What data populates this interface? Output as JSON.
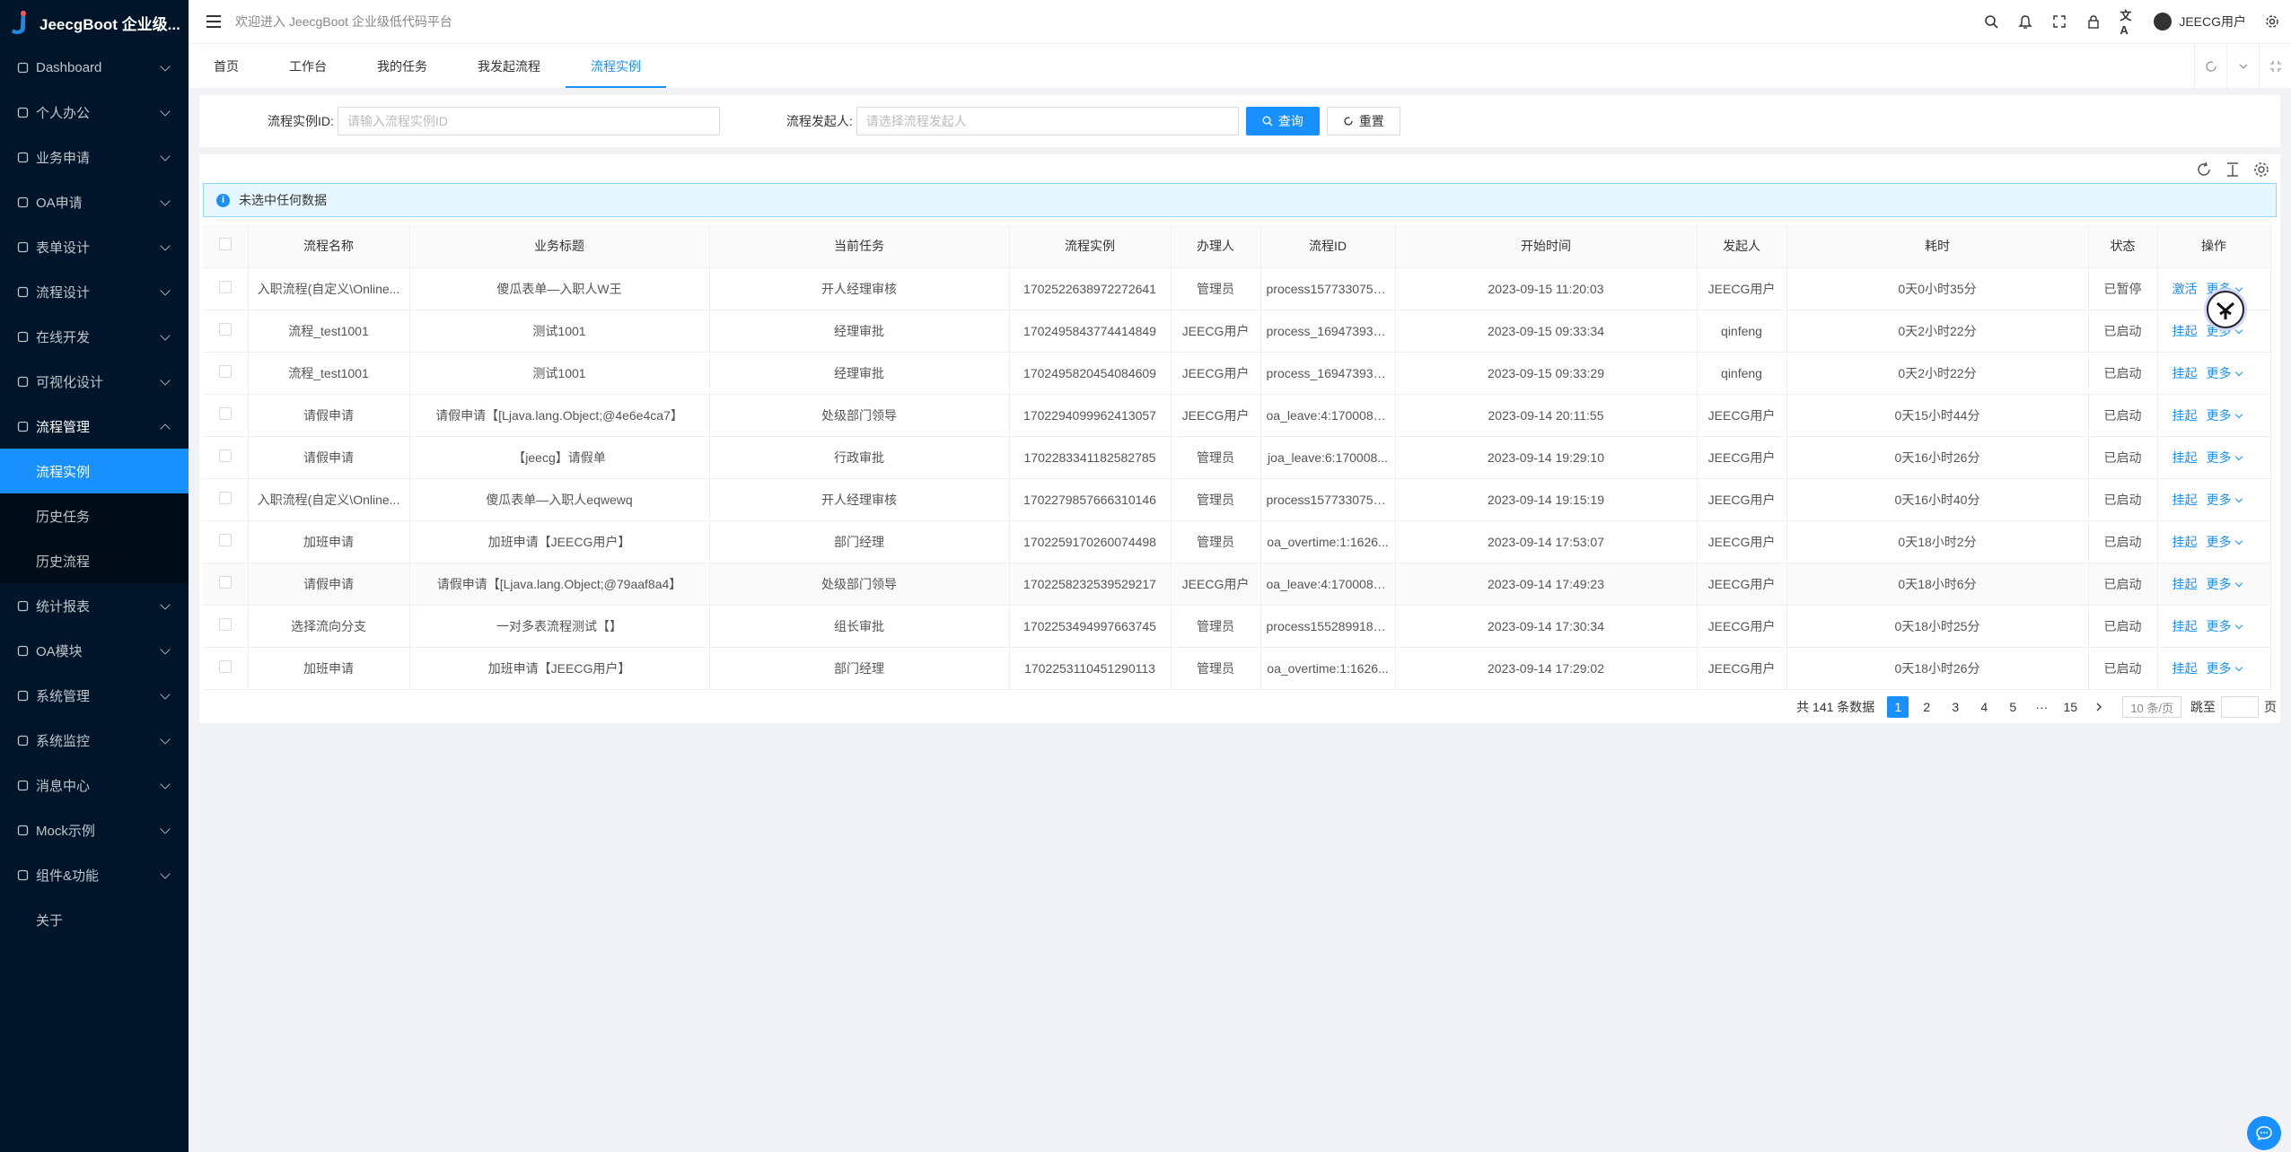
{
  "app": {
    "title": "JeecgBoot 企业级..."
  },
  "header": {
    "welcome": "欢迎进入 JeecgBoot 企业级低代码平台",
    "user_name": "JEECG用户"
  },
  "sidebar": {
    "items": [
      {
        "label": "Dashboard",
        "icon": "dashboard-icon"
      },
      {
        "label": "个人办公",
        "icon": "coffee-icon"
      },
      {
        "label": "业务申请",
        "icon": "tag-icon"
      },
      {
        "label": "OA申请",
        "icon": "oa-icon"
      },
      {
        "label": "表单设计",
        "icon": "form-icon"
      },
      {
        "label": "流程设计",
        "icon": "flow-icon"
      },
      {
        "label": "在线开发",
        "icon": "cloud-icon"
      },
      {
        "label": "可视化设计",
        "icon": "screen-icon"
      },
      {
        "label": "流程管理",
        "icon": "process-icon"
      },
      {
        "label": "统计报表",
        "icon": "chart-icon"
      },
      {
        "label": "OA模块",
        "icon": "oa-module-icon"
      },
      {
        "label": "系统管理",
        "icon": "settings-icon"
      },
      {
        "label": "系统监控",
        "icon": "monitor-icon"
      },
      {
        "label": "消息中心",
        "icon": "message-icon"
      },
      {
        "label": "Mock示例",
        "icon": "mock-icon"
      },
      {
        "label": "组件&功能",
        "icon": "component-icon"
      },
      {
        "label": "关于",
        "icon": ""
      }
    ],
    "sub_items": [
      {
        "label": "流程实例"
      },
      {
        "label": "历史任务"
      },
      {
        "label": "历史流程"
      }
    ]
  },
  "tabs": [
    {
      "label": "首页"
    },
    {
      "label": "工作台"
    },
    {
      "label": "我的任务"
    },
    {
      "label": "我发起流程"
    },
    {
      "label": "流程实例"
    }
  ],
  "search": {
    "instance_label": "流程实例ID:",
    "instance_placeholder": "请输入流程实例ID",
    "starter_label": "流程发起人:",
    "starter_placeholder": "请选择流程发起人",
    "query_label": "查询",
    "reset_label": "重置"
  },
  "alert": {
    "text": "未选中任何数据"
  },
  "table": {
    "columns": [
      "流程名称",
      "业务标题",
      "当前任务",
      "流程实例",
      "办理人",
      "流程ID",
      "开始时间",
      "发起人",
      "耗时",
      "状态",
      "操作"
    ],
    "rows": [
      {
        "name": "入职流程(自定义\\Online...",
        "title": "傻瓜表单—入职人W王",
        "task": "开人经理审核",
        "instance": "1702522638972272641",
        "handler": "管理员",
        "pid": "process1577330752...",
        "start": "2023-09-15 11:20:03",
        "starter": "JEECG用户",
        "cost": "0天0小时35分",
        "status": "已暂停",
        "action": "激活",
        "more": "更多"
      },
      {
        "name": "流程_test1001",
        "title": "测试1001",
        "task": "经理审批",
        "instance": "1702495843774414849",
        "handler": "JEECG用户",
        "pid": "process_169473934...",
        "start": "2023-09-15 09:33:34",
        "starter": "qinfeng",
        "cost": "0天2小时22分",
        "status": "已启动",
        "action": "挂起",
        "more": "更多"
      },
      {
        "name": "流程_test1001",
        "title": "测试1001",
        "task": "经理审批",
        "instance": "1702495820454084609",
        "handler": "JEECG用户",
        "pid": "process_169473934...",
        "start": "2023-09-15 09:33:29",
        "starter": "qinfeng",
        "cost": "0天2小时22分",
        "status": "已启动",
        "action": "挂起",
        "more": "更多"
      },
      {
        "name": "请假申请",
        "title": "请假申请【[Ljava.lang.Object;@4e6e4ca7】",
        "task": "处级部门领导",
        "instance": "1702294099962413057",
        "handler": "JEECG用户",
        "pid": "oa_leave:4:1700085...",
        "start": "2023-09-14 20:11:55",
        "starter": "JEECG用户",
        "cost": "0天15小时44分",
        "status": "已启动",
        "action": "挂起",
        "more": "更多"
      },
      {
        "name": "请假申请",
        "title": "【jeecg】请假单",
        "task": "行政审批",
        "instance": "1702283341182582785",
        "handler": "管理员",
        "pid": "joa_leave:6:170008...",
        "start": "2023-09-14 19:29:10",
        "starter": "JEECG用户",
        "cost": "0天16小时26分",
        "status": "已启动",
        "action": "挂起",
        "more": "更多"
      },
      {
        "name": "入职流程(自定义\\Online...",
        "title": "傻瓜表单—入职人eqwewq",
        "task": "开人经理审核",
        "instance": "1702279857666310146",
        "handler": "管理员",
        "pid": "process1577330752...",
        "start": "2023-09-14 19:15:19",
        "starter": "JEECG用户",
        "cost": "0天16小时40分",
        "status": "已启动",
        "action": "挂起",
        "more": "更多"
      },
      {
        "name": "加班申请",
        "title": "加班申请【JEECG用户】",
        "task": "部门经理",
        "instance": "1702259170260074498",
        "handler": "管理员",
        "pid": "oa_overtime:1:1626...",
        "start": "2023-09-14 17:53:07",
        "starter": "JEECG用户",
        "cost": "0天18小时2分",
        "status": "已启动",
        "action": "挂起",
        "more": "更多"
      },
      {
        "name": "请假申请",
        "title": "请假申请【[Ljava.lang.Object;@79aaf8a4】",
        "task": "处级部门领导",
        "instance": "1702258232539529217",
        "handler": "JEECG用户",
        "pid": "oa_leave:4:1700085...",
        "start": "2023-09-14 17:49:23",
        "starter": "JEECG用户",
        "cost": "0天18小时6分",
        "status": "已启动",
        "action": "挂起",
        "more": "更多"
      },
      {
        "name": "选择流向分支",
        "title": "一对多表流程测试【】",
        "task": "组长审批",
        "instance": "1702253494997663745",
        "handler": "管理员",
        "pid": "process1552899184...",
        "start": "2023-09-14 17:30:34",
        "starter": "JEECG用户",
        "cost": "0天18小时25分",
        "status": "已启动",
        "action": "挂起",
        "more": "更多"
      },
      {
        "name": "加班申请",
        "title": "加班申请【JEECG用户】",
        "task": "部门经理",
        "instance": "1702253110451290113",
        "handler": "管理员",
        "pid": "oa_overtime:1:1626...",
        "start": "2023-09-14 17:29:02",
        "starter": "JEECG用户",
        "cost": "0天18小时26分",
        "status": "已启动",
        "action": "挂起",
        "more": "更多"
      }
    ]
  },
  "pagination": {
    "total": "共 141 条数据",
    "pages": [
      "1",
      "2",
      "3",
      "4",
      "5",
      "···",
      "15"
    ],
    "page_size": "10 条/页",
    "jump_label": "跳至",
    "page_unit": "页"
  },
  "colors": {
    "primary": "#1890ff",
    "sidebar": "#001529"
  }
}
